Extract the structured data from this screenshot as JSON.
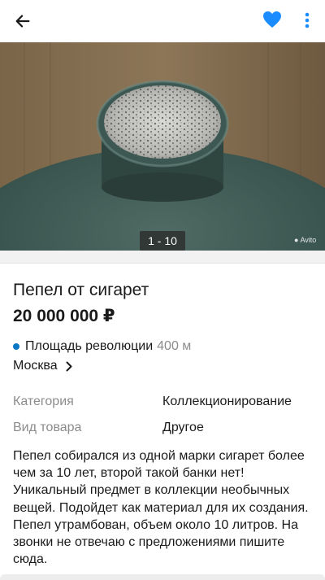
{
  "header": {
    "back_icon": "arrow-left-icon",
    "favorite_icon": "heart-icon",
    "more_icon": "more-vertical-icon",
    "favorite_color": "#1a8cff"
  },
  "gallery": {
    "counter": "1 - 10",
    "watermark": "Avito"
  },
  "listing": {
    "title": "Пепел от сигарет",
    "price": "20 000 000 ₽",
    "metro_station": "Площадь революции",
    "metro_distance": "400 м",
    "metro_color": "#0a76c5",
    "city": "Москва"
  },
  "params": [
    {
      "label": "Категория",
      "value": "Коллекционирование"
    },
    {
      "label": "Вид товара",
      "value": "Другое"
    }
  ],
  "description": "Пепел собирался из одной марки сигарет более чем за 10 лет, второй такой банки нет! Уникальный предмет в коллекции необычных вещей. Подойдет как материал для их создания. Пепел утрамбован, объем около 10 литров. На звонки не отвечаю с предложениями пишите сюда."
}
